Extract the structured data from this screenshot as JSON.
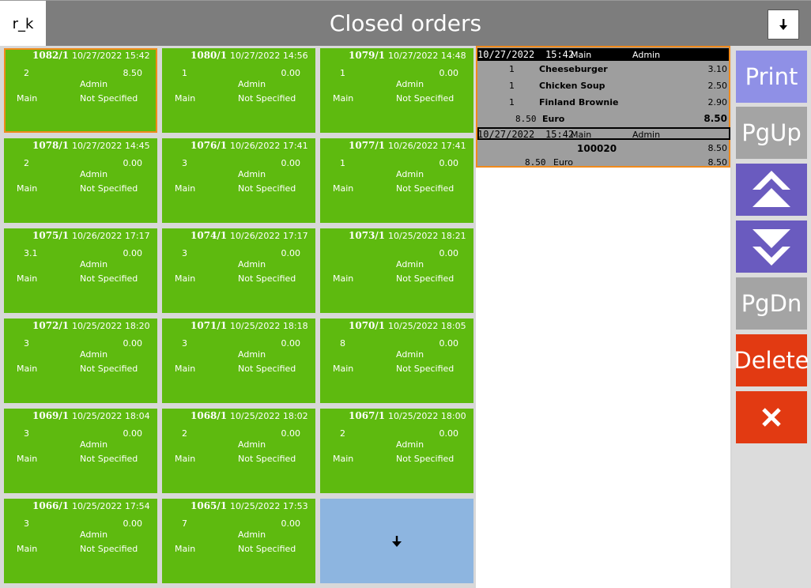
{
  "header": {
    "logo": "r_k",
    "title": "Closed orders",
    "scroll_icon": "arrow-down-icon"
  },
  "orders": [
    {
      "number": "1082/1",
      "datetime": "10/27/2022 15:42",
      "guests": "2",
      "amount": "8.50",
      "waiter": "Admin",
      "hall": "Main",
      "table": "Not Specified",
      "selected": true
    },
    {
      "number": "1080/1",
      "datetime": "10/27/2022 14:56",
      "guests": "1",
      "amount": "0.00",
      "waiter": "Admin",
      "hall": "Main",
      "table": "Not Specified"
    },
    {
      "number": "1079/1",
      "datetime": "10/27/2022 14:48",
      "guests": "1",
      "amount": "0.00",
      "waiter": "Admin",
      "hall": "Main",
      "table": "Not Specified"
    },
    {
      "number": "1078/1",
      "datetime": "10/27/2022 14:45",
      "guests": "2",
      "amount": "0.00",
      "waiter": "Admin",
      "hall": "Main",
      "table": "Not Specified"
    },
    {
      "number": "1076/1",
      "datetime": "10/26/2022 17:41",
      "guests": "3",
      "amount": "0.00",
      "waiter": "Admin",
      "hall": "Main",
      "table": "Not Specified"
    },
    {
      "number": "1077/1",
      "datetime": "10/26/2022 17:41",
      "guests": "1",
      "amount": "0.00",
      "waiter": "Admin",
      "hall": "Main",
      "table": "Not Specified"
    },
    {
      "number": "1075/1",
      "datetime": "10/26/2022 17:17",
      "guests": "3.1",
      "amount": "0.00",
      "waiter": "Admin",
      "hall": "Main",
      "table": "Not Specified"
    },
    {
      "number": "1074/1",
      "datetime": "10/26/2022 17:17",
      "guests": "3",
      "amount": "0.00",
      "waiter": "Admin",
      "hall": "Main",
      "table": "Not Specified"
    },
    {
      "number": "1073/1",
      "datetime": "10/25/2022 18:21",
      "guests": "",
      "amount": "0.00",
      "waiter": "Admin",
      "hall": "Main",
      "table": "Not Specified"
    },
    {
      "number": "1072/1",
      "datetime": "10/25/2022 18:20",
      "guests": "3",
      "amount": "0.00",
      "waiter": "Admin",
      "hall": "Main",
      "table": "Not Specified"
    },
    {
      "number": "1071/1",
      "datetime": "10/25/2022 18:18",
      "guests": "3",
      "amount": "0.00",
      "waiter": "Admin",
      "hall": "Main",
      "table": "Not Specified"
    },
    {
      "number": "1070/1",
      "datetime": "10/25/2022 18:05",
      "guests": "8",
      "amount": "0.00",
      "waiter": "Admin",
      "hall": "Main",
      "table": "Not Specified"
    },
    {
      "number": "1069/1",
      "datetime": "10/25/2022 18:04",
      "guests": "3",
      "amount": "0.00",
      "waiter": "Admin",
      "hall": "Main",
      "table": "Not Specified"
    },
    {
      "number": "1068/1",
      "datetime": "10/25/2022 18:02",
      "guests": "2",
      "amount": "0.00",
      "waiter": "Admin",
      "hall": "Main",
      "table": "Not Specified"
    },
    {
      "number": "1067/1",
      "datetime": "10/25/2022 18:00",
      "guests": "2",
      "amount": "0.00",
      "waiter": "Admin",
      "hall": "Main",
      "table": "Not Specified"
    },
    {
      "number": "1066/1",
      "datetime": "10/25/2022 17:54",
      "guests": "3",
      "amount": "0.00",
      "waiter": "Admin",
      "hall": "Main",
      "table": "Not Specified"
    },
    {
      "number": "1065/1",
      "datetime": "10/25/2022 17:53",
      "guests": "7",
      "amount": "0.00",
      "waiter": "Admin",
      "hall": "Main",
      "table": "Not Specified"
    }
  ],
  "more_icon": "arrow-down-icon",
  "receipt": {
    "header": {
      "date": "10/27/2022",
      "time": "15:42",
      "hall": "Main",
      "waiter": "Admin"
    },
    "items": [
      {
        "qty": "1",
        "name": "Cheeseburger",
        "price": "3.10"
      },
      {
        "qty": "1",
        "name": "Chicken Soup",
        "price": "2.50"
      },
      {
        "qty": "1",
        "name": "Finland Brownie",
        "price": "2.90"
      }
    ],
    "currency_line": {
      "amount": "8.50",
      "currency": "Euro",
      "total": "8.50"
    },
    "payment_header": {
      "date": "10/27/2022",
      "time": "15:42",
      "hall": "Main",
      "waiter": "Admin"
    },
    "payment_code": {
      "code": "100020",
      "total": "8.50"
    },
    "payment_line": {
      "amount": "8.50",
      "currency": "Euro",
      "total": "8.50"
    }
  },
  "sidebar": {
    "print": "Print",
    "pgup": "PgUp",
    "pgdn": "PgDn",
    "delete": "Delete",
    "up_icon": "double-chevron-up-icon",
    "down_icon": "double-chevron-down-icon",
    "close_icon": "close-icon"
  },
  "colors": {
    "tile": "#5eba0f",
    "selected_border": "#f08a1c",
    "print": "#8f90e6",
    "nav": "#6a5bbf",
    "page": "#a4a4a4",
    "delete": "#e23a12",
    "close": "#e23a12"
  }
}
